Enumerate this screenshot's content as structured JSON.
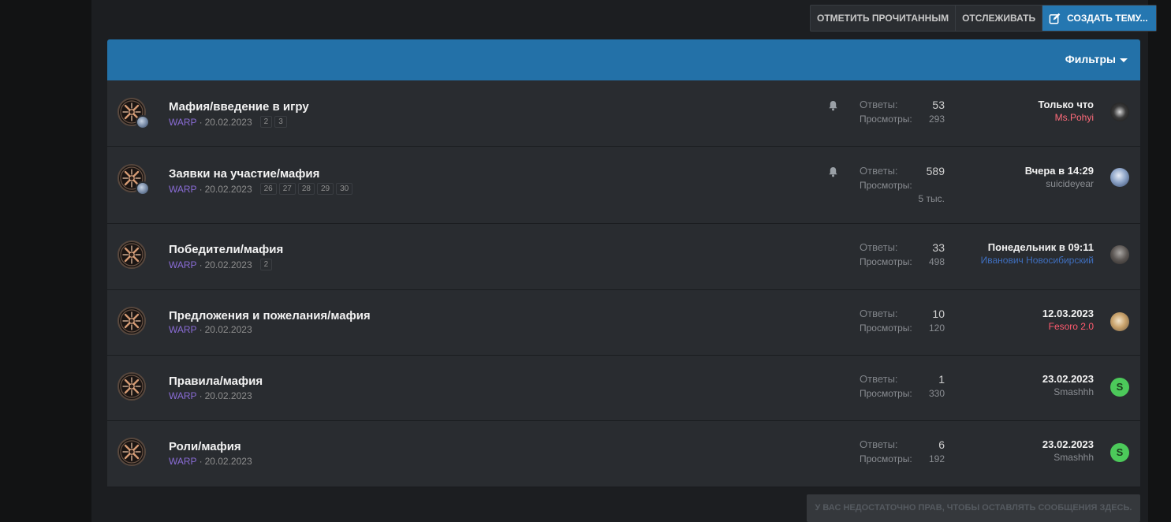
{
  "actions": {
    "mark_read": "ОТМЕТИТЬ ПРОЧИТАННЫМ",
    "watch": "ОТСЛЕЖИВАТЬ",
    "create_topic": "СОЗДАТЬ ТЕМУ..."
  },
  "filters": {
    "label": "Фильтры"
  },
  "stats_labels": {
    "replies": "Ответы:",
    "views": "Просмотры:"
  },
  "threads": [
    {
      "title": "Мафия/введение в игру",
      "author": "WARP",
      "date": "20.02.2023",
      "pages": [
        "2",
        "3"
      ],
      "watched": true,
      "replies": "53",
      "views": "293",
      "views_extra": "",
      "latest_date": "Только что",
      "latest_user": "Ms.Pohyi",
      "latest_user_color": "#ff6b7a",
      "latest_avatar": "dark-logo"
    },
    {
      "title": "Заявки на участие/мафия",
      "author": "WARP",
      "date": "20.02.2023",
      "pages": [
        "26",
        "27",
        "28",
        "29",
        "30"
      ],
      "watched": true,
      "replies": "589",
      "views": "",
      "views_extra": "5 тыс.",
      "latest_date": "Вчера в 14:29",
      "latest_user": "suicideyear",
      "latest_user_color": "#8a8d92",
      "latest_avatar": "photo-blue"
    },
    {
      "title": "Победители/мафия",
      "author": "WARP",
      "date": "20.02.2023",
      "pages": [
        "2"
      ],
      "watched": false,
      "replies": "33",
      "views": "498",
      "views_extra": "",
      "latest_date": "Понедельник в 09:11",
      "latest_user": "Иванович Новосибирский",
      "latest_user_color": "#3f6fbf",
      "latest_avatar": "photo-grey"
    },
    {
      "title": "Предложения и пожелания/мафия",
      "author": "WARP",
      "date": "20.02.2023",
      "pages": [],
      "watched": false,
      "replies": "10",
      "views": "120",
      "views_extra": "",
      "latest_date": "12.03.2023",
      "latest_user": "Fesoro 2.0",
      "latest_user_color": "#ff5a6e",
      "latest_avatar": "photo-warm"
    },
    {
      "title": "Правила/мафия",
      "author": "WARP",
      "date": "20.02.2023",
      "pages": [],
      "watched": false,
      "replies": "1",
      "views": "330",
      "views_extra": "",
      "latest_date": "23.02.2023",
      "latest_user": "Smashhh",
      "latest_user_color": "#8a8d92",
      "latest_avatar": "letter",
      "latest_letter": "S"
    },
    {
      "title": "Роли/мафия",
      "author": "WARP",
      "date": "20.02.2023",
      "pages": [],
      "watched": false,
      "replies": "6",
      "views": "192",
      "views_extra": "",
      "latest_date": "23.02.2023",
      "latest_user": "Smashhh",
      "latest_user_color": "#8a8d92",
      "latest_avatar": "letter",
      "latest_letter": "S"
    }
  ],
  "no_permission": "У ВАС НЕДОСТАТОЧНО ПРАВ, ЧТОБЫ ОСТАВЛЯТЬ СООБЩЕНИЯ ЗДЕСЬ."
}
